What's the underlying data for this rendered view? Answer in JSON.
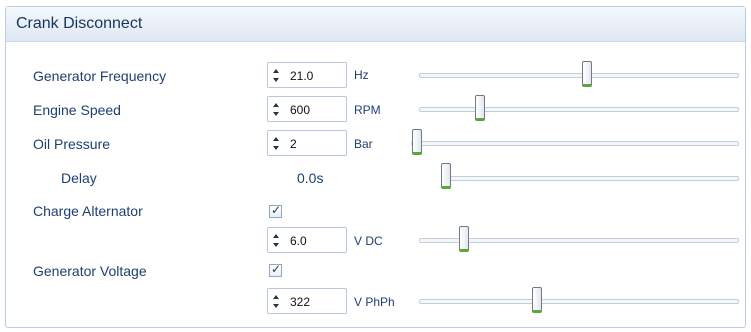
{
  "panel": {
    "title": "Crank Disconnect"
  },
  "rows": {
    "generator_frequency": {
      "label": "Generator Frequency",
      "value": "21.0",
      "unit": "Hz",
      "slider_fraction": 0.52
    },
    "engine_speed": {
      "label": "Engine Speed",
      "value": "600",
      "unit": "RPM",
      "slider_fraction": 0.2
    },
    "oil_pressure": {
      "label": "Oil Pressure",
      "value": "2",
      "unit": "Bar",
      "slider_fraction": 0.0
    },
    "delay": {
      "label": "Delay",
      "value": "0.0s",
      "slider_fraction": 0.0
    },
    "charge_alternator": {
      "label": "Charge Alternator",
      "checked": true,
      "check_glyph": "✓",
      "value": "6.0",
      "unit": "V DC",
      "slider_fraction": 0.15
    },
    "generator_voltage": {
      "label": "Generator Voltage",
      "checked": true,
      "check_glyph": "✓",
      "value": "322",
      "unit": "V PhPh",
      "slider_fraction": 0.39
    }
  },
  "colors": {
    "accent": "#1d3f73",
    "thumb_accent": "#5aa83a",
    "header_bg": "#dfe8f3"
  },
  "icons": {
    "spin": "spin-arrows-icon",
    "check": "checkmark-icon"
  }
}
